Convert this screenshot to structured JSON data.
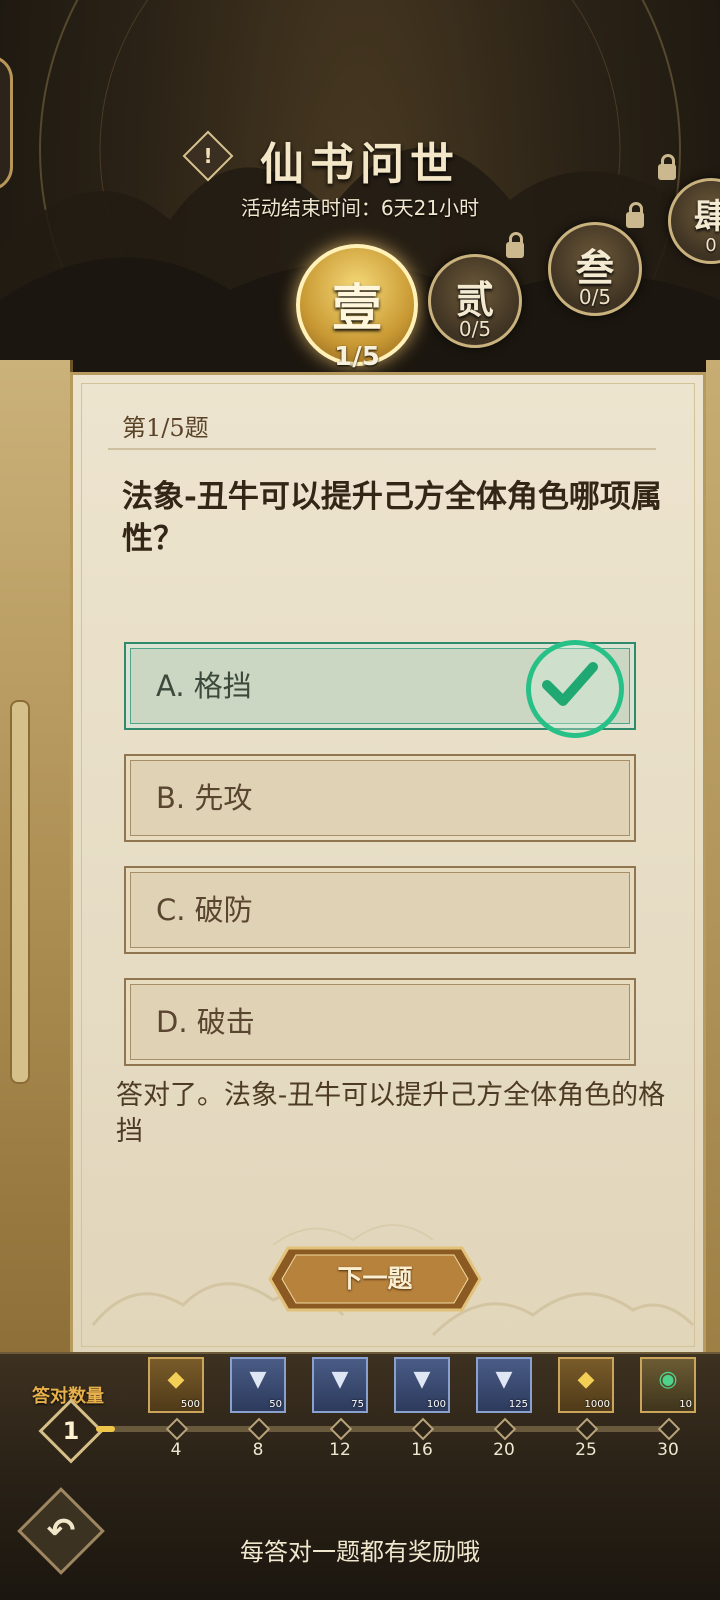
{
  "header": {
    "title": "仙书问世",
    "info_icon": "!",
    "end_time": "活动结束时间：6天21小时"
  },
  "stages": [
    {
      "num": "壹",
      "count": "1/5",
      "state": "active"
    },
    {
      "num": "贰",
      "count": "0/5",
      "state": "locked"
    },
    {
      "num": "叁",
      "count": "0/5",
      "state": "locked"
    },
    {
      "num": "肆",
      "count": "0",
      "state": "locked"
    }
  ],
  "quiz": {
    "question_number": "第1/5题",
    "question": "法象-丑牛可以提升己方全体角色哪项属性？",
    "options": [
      {
        "label": "A. 格挡",
        "state": "correct"
      },
      {
        "label": "B. 先攻",
        "state": "normal"
      },
      {
        "label": "C. 破防",
        "state": "normal"
      },
      {
        "label": "D. 破击",
        "state": "normal"
      }
    ],
    "explanation": "答对了。法象-丑牛可以提升己方全体角色的格挡",
    "next_button": "下一题"
  },
  "progress": {
    "label": "答对数量",
    "correct_count": "1",
    "fraction": 0.033,
    "milestones": [
      "4",
      "8",
      "12",
      "16",
      "20",
      "25",
      "30"
    ],
    "rewards": [
      {
        "icon": "gold-ingot-icon",
        "qty": "500",
        "kind": "gold"
      },
      {
        "icon": "material-bag-icon",
        "qty": "50",
        "kind": "blue"
      },
      {
        "icon": "material-bag-icon",
        "qty": "75",
        "kind": "blue"
      },
      {
        "icon": "material-bag-icon",
        "qty": "100",
        "kind": "blue"
      },
      {
        "icon": "material-bag-icon",
        "qty": "125",
        "kind": "blue"
      },
      {
        "icon": "gold-ingot-icon",
        "qty": "1000",
        "kind": "gold"
      },
      {
        "icon": "jade-dragon-icon",
        "qty": "10",
        "kind": "green"
      }
    ]
  },
  "footer": {
    "back_icon": "back-arrow-icon",
    "hint": "每答对一题都有奖励哦"
  },
  "colors": {
    "correct": "#27c087",
    "gold": "#f0c64a"
  }
}
